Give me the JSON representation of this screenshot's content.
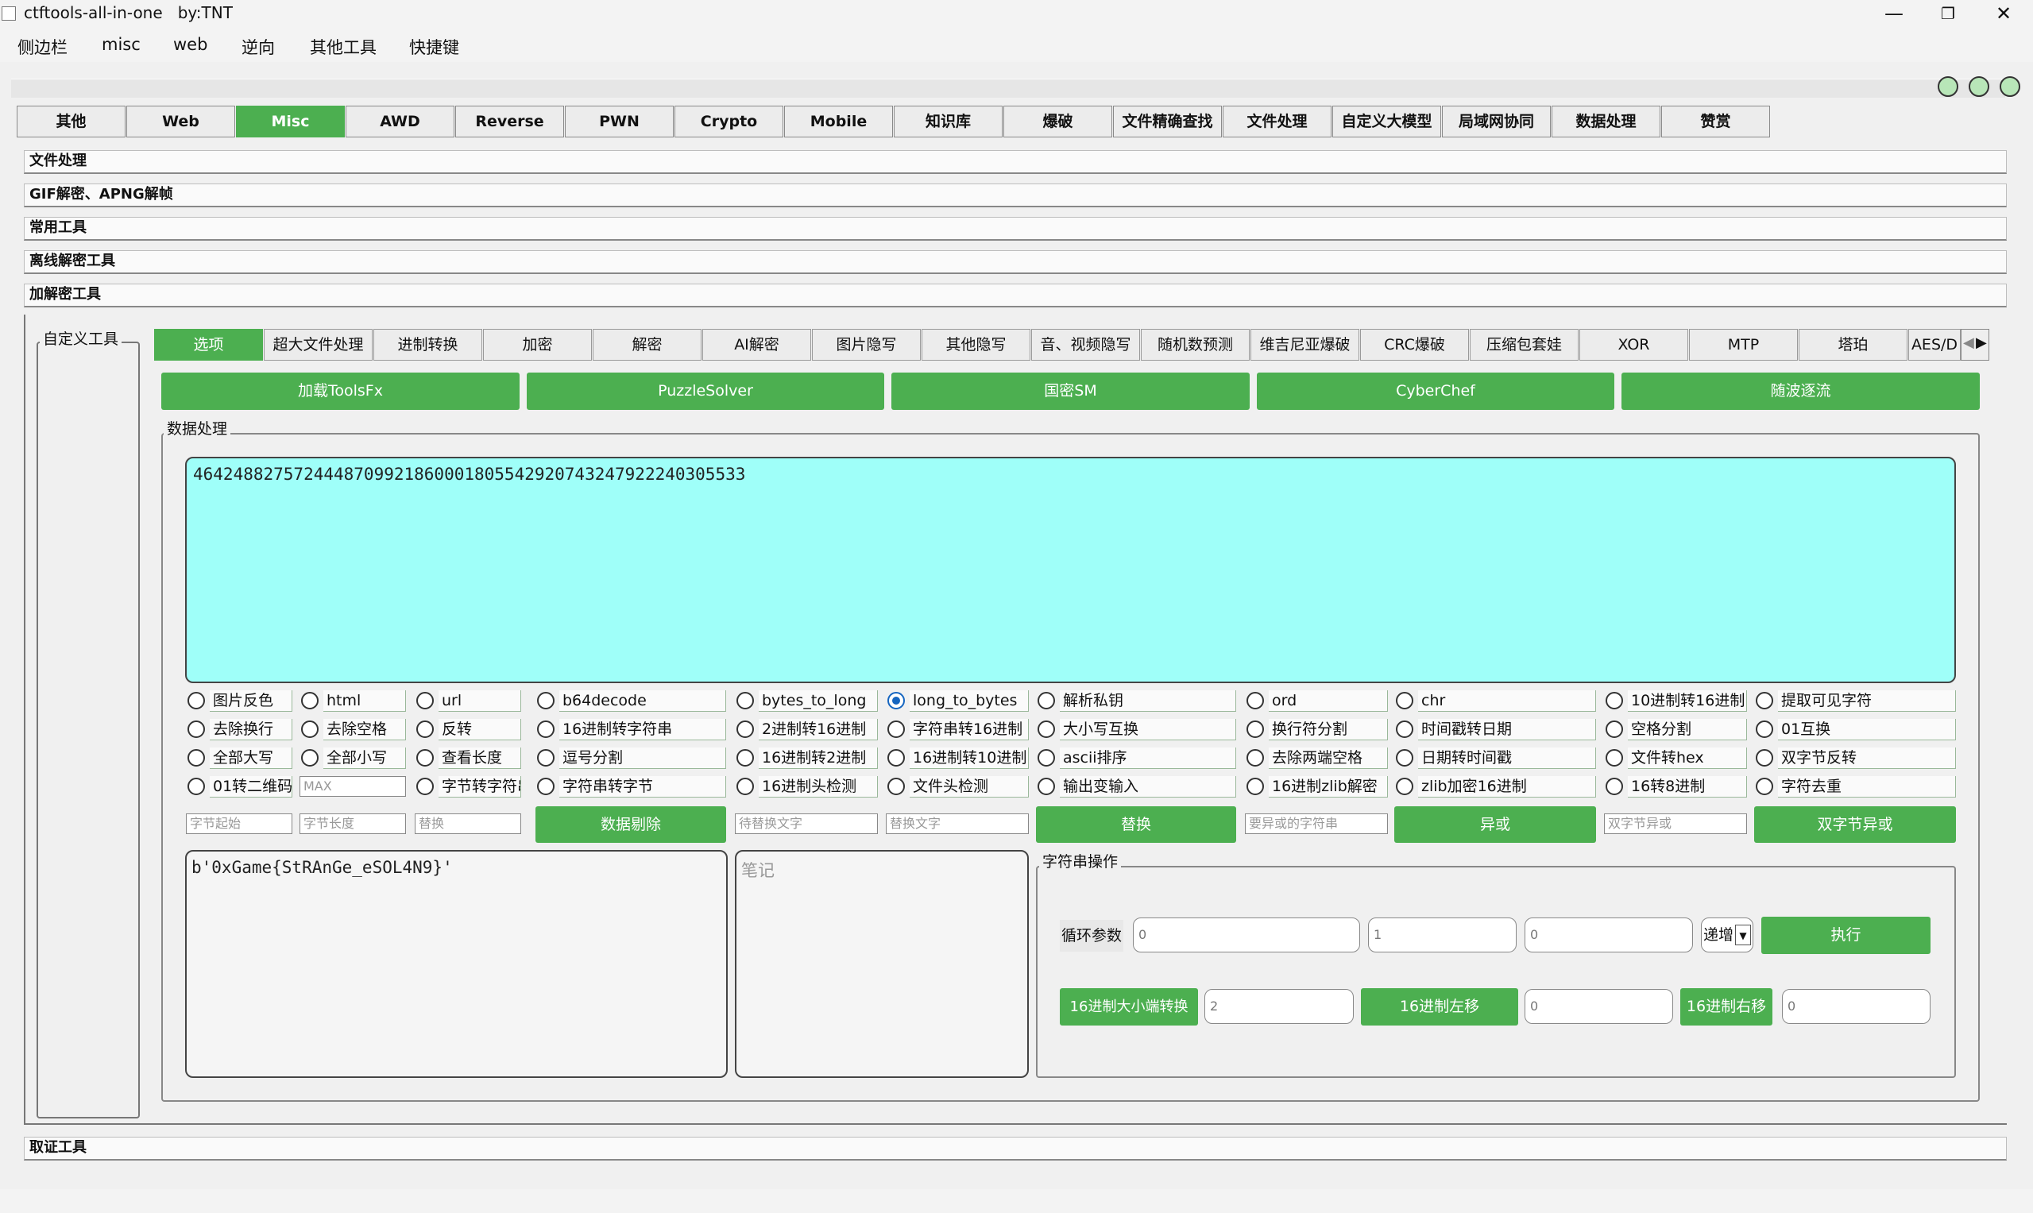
{
  "window": {
    "title": "ctftools-all-in-one   by:TNT",
    "minimize": "—",
    "maximize": "❐",
    "close": "✕"
  },
  "menu": [
    "侧边栏",
    "misc",
    "web",
    "逆向",
    "其他工具",
    "快捷键"
  ],
  "top_tabs": [
    "其他",
    "Web",
    "Misc",
    "AWD",
    "Reverse",
    "PWN",
    "Crypto",
    "Mobile",
    "知识库",
    "爆破",
    "文件精确查找",
    "文件处理",
    "自定义大模型",
    "局域网协同",
    "数据处理",
    "赞赏"
  ],
  "top_tab_active": "Misc",
  "sections": [
    "文件处理",
    "GIF解密、APNG解帧",
    "常用工具",
    "离线解密工具",
    "加解密工具"
  ],
  "custom_tools_label": "自定义工具",
  "inner_tabs": [
    "选项",
    "超大文件处理",
    "进制转换",
    "加密",
    "解密",
    "AI解密",
    "图片隐写",
    "其他隐写",
    "音、视频隐写",
    "随机数预测",
    "维吉尼亚爆破",
    "CRC爆破",
    "压缩包套娃",
    "XOR",
    "MTP",
    "塔珀",
    "AES/D"
  ],
  "inner_tab_active": "选项",
  "tool_buttons": [
    "加载ToolsFx",
    "PuzzleSolver",
    "国密SM",
    "CyberChef",
    "随波逐流"
  ],
  "data_group_label": "数据处理",
  "input_text": "464248827572444870992186000180554292074324792224030553​3",
  "options": [
    [
      "图片反色",
      "html",
      "url",
      "b64decode",
      "bytes_to_long",
      "long_to_bytes",
      "解析私钥",
      "ord",
      "chr",
      "10进制转16进制",
      "提取可见字符"
    ],
    [
      "去除换行",
      "去除空格",
      "反转",
      "16进制转字符串",
      "2进制转16进制",
      "字符串转16进制",
      "大小写互换",
      "换行符分割",
      "时间戳转日期",
      "空格分割",
      "01互换"
    ],
    [
      "全部大写",
      "全部小写",
      "查看长度",
      "逗号分割",
      "16进制转2进制",
      "16进制转10进制",
      "ascii排序",
      "去除两端空格",
      "日期转时间戳",
      "文件转hex",
      "双字节反转"
    ],
    [
      "01转二维码",
      "",
      "字节转字符串",
      "字符串转字节",
      "16进制头检测",
      "文件头检测",
      "输出变输入",
      "16进制zlib解密",
      "zlib加密16进制",
      "16转8进制",
      "字符去重"
    ]
  ],
  "selected_option": "long_to_bytes",
  "max_placeholder": "MAX",
  "row5": {
    "byte_start_ph": "字节起始",
    "byte_len_ph": "字节长度",
    "replace_ph": "替换",
    "delete_btn": "数据剔除",
    "to_replace_ph": "待替换文字",
    "replace_text_ph": "替换文字",
    "replace_btn": "替换",
    "xor_str_ph": "要异或的字符串",
    "xor_btn": "异或",
    "dbyte_xor_ph": "双字节异或",
    "dbyte_xor_btn": "双字节异或"
  },
  "output_text": "b'0xGame{StRAnGe_eSOL4N9}'",
  "notes_placeholder": "笔记",
  "string_ops": {
    "label": "字符串操作",
    "loop_label": "循环参数",
    "loop_values": [
      "0",
      "1",
      "0"
    ],
    "mode": "递增",
    "exec_btn": "执行",
    "endian_btn": "16进制大小端转换",
    "endian_value": "2",
    "shl_btn": "16进制左移",
    "shl_value": "0",
    "shr_btn": "16进制右移",
    "shr_value": "0"
  },
  "forensics_label": "取证工具"
}
